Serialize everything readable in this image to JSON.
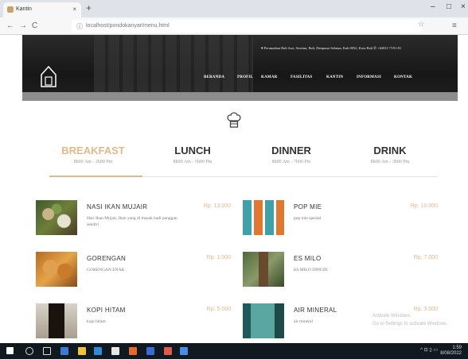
{
  "browser": {
    "tab_title": "Kantin",
    "new_tab": "+",
    "close_tab": "×",
    "back": "←",
    "forward": "→",
    "reload": "C",
    "url": "localhost/pondokanyar/menu.html",
    "minimize": "–",
    "maximize": "□",
    "close": "×",
    "menu": "≡"
  },
  "site": {
    "contact": "♥ Perumahan Bali Asri, Sesetan, Bali, Denpasar Selatan, Kab 0032, Kota Bali   ✆ +62811-7191-81",
    "nav": [
      "BERANDA",
      "PROFIL",
      "KAMAR",
      "FASILITAS",
      "KANTIN",
      "INFORMASI",
      "KONTAK"
    ]
  },
  "categories": [
    {
      "title": "BREAKFAST",
      "hours": "8h00 Am - 2h00 Pm",
      "active": true
    },
    {
      "title": "LUNCH",
      "hours": "8h00 Am - 5h00 Pm",
      "active": false
    },
    {
      "title": "DINNER",
      "hours": "8h00 Am - 7h00 Pm",
      "active": false
    },
    {
      "title": "DRINK",
      "hours": "8h00 Am - 3h00 Pm",
      "active": false
    }
  ],
  "items_left": [
    {
      "name": "NASI IKAN MUJAIR",
      "desc": "Hari Ikan Mujair, Ikan yang di masak hadi panggan sendiri",
      "price": "Rp. 13.000"
    },
    {
      "name": "GORENGAN",
      "desc": "GORENGAN ENAK",
      "price": "Rp. 1.000"
    },
    {
      "name": "KOPI HITAM",
      "desc": "kopi hitam",
      "price": "Rp. 5.000"
    }
  ],
  "items_right": [
    {
      "name": "POP MIE",
      "desc": "pop mie spesial",
      "price": "Rp. 10.000"
    },
    {
      "name": "ES MILO",
      "desc": "ES MILO DINGIN",
      "price": "Rp. 7.000"
    },
    {
      "name": "AIR MINERAL",
      "desc": "air mineral",
      "price": "Rp. 3.000"
    }
  ],
  "watermark": {
    "line1": "Activate Windows",
    "line2": "Go to Settings to activate Windows."
  },
  "taskbar": {
    "time": "1:59",
    "date": "8/08/2022",
    "tray": "^ ⊡ ▯ ▭"
  },
  "colors": {
    "accent": "#e2b98a",
    "dark": "#1a1a1a",
    "text": "#333333"
  }
}
